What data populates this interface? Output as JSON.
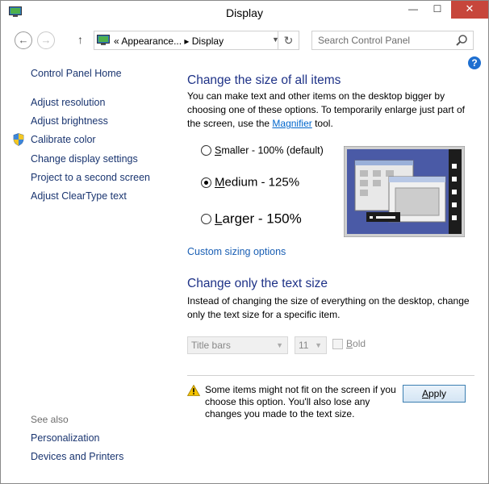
{
  "window": {
    "title": "Display",
    "close_glyph": "✕",
    "minimize_glyph": "—",
    "maximize_glyph": "☐"
  },
  "nav": {
    "back_icon": "back-arrow-icon",
    "forward_icon": "forward-arrow-icon",
    "up_icon": "up-arrow-icon",
    "breadcrumb": "«  Appearance...  ▸  Display",
    "search_placeholder": "Search Control Panel"
  },
  "sidebar": {
    "home": "Control Panel Home",
    "items": [
      {
        "label": "Adjust resolution"
      },
      {
        "label": "Adjust brightness"
      },
      {
        "label": "Calibrate color"
      },
      {
        "label": "Change display settings"
      },
      {
        "label": "Project to a second screen"
      },
      {
        "label": "Adjust ClearType text"
      }
    ],
    "see_also_heading": "See also",
    "see_also": [
      {
        "label": "Personalization"
      },
      {
        "label": "Devices and Printers"
      }
    ]
  },
  "main": {
    "heading1": "Change the size of all items",
    "para1_before": "You can make text and other items on the desktop bigger by choosing one of these options. To temporarily enlarge just part of the screen, use the ",
    "para1_link": "Magnifier",
    "para1_after": " tool.",
    "options": [
      {
        "accel": "S",
        "rest": "maller - 100% (default)",
        "checked": false
      },
      {
        "accel": "M",
        "rest": "edium - 125%",
        "checked": true
      },
      {
        "accel": "L",
        "rest": "arger - 150%",
        "checked": false
      }
    ],
    "custom_sizing": "Custom sizing options",
    "heading2": "Change only the text size",
    "para2": "Instead of changing the size of everything on the desktop, change only the text size for a specific item.",
    "item_select": "Title bars",
    "size_select": "11",
    "bold_accel": "B",
    "bold_rest": "old",
    "warning": "Some items might not fit on the screen if you choose this option. You'll also lose any changes you made to the text size.",
    "apply_label": "Apply",
    "apply_accel": "A",
    "apply_rest": "pply"
  },
  "colors": {
    "heading": "#1e3287",
    "link": "#1a3570",
    "close_button": "#c7463b",
    "preview_desktop": "#4a5aa6"
  }
}
